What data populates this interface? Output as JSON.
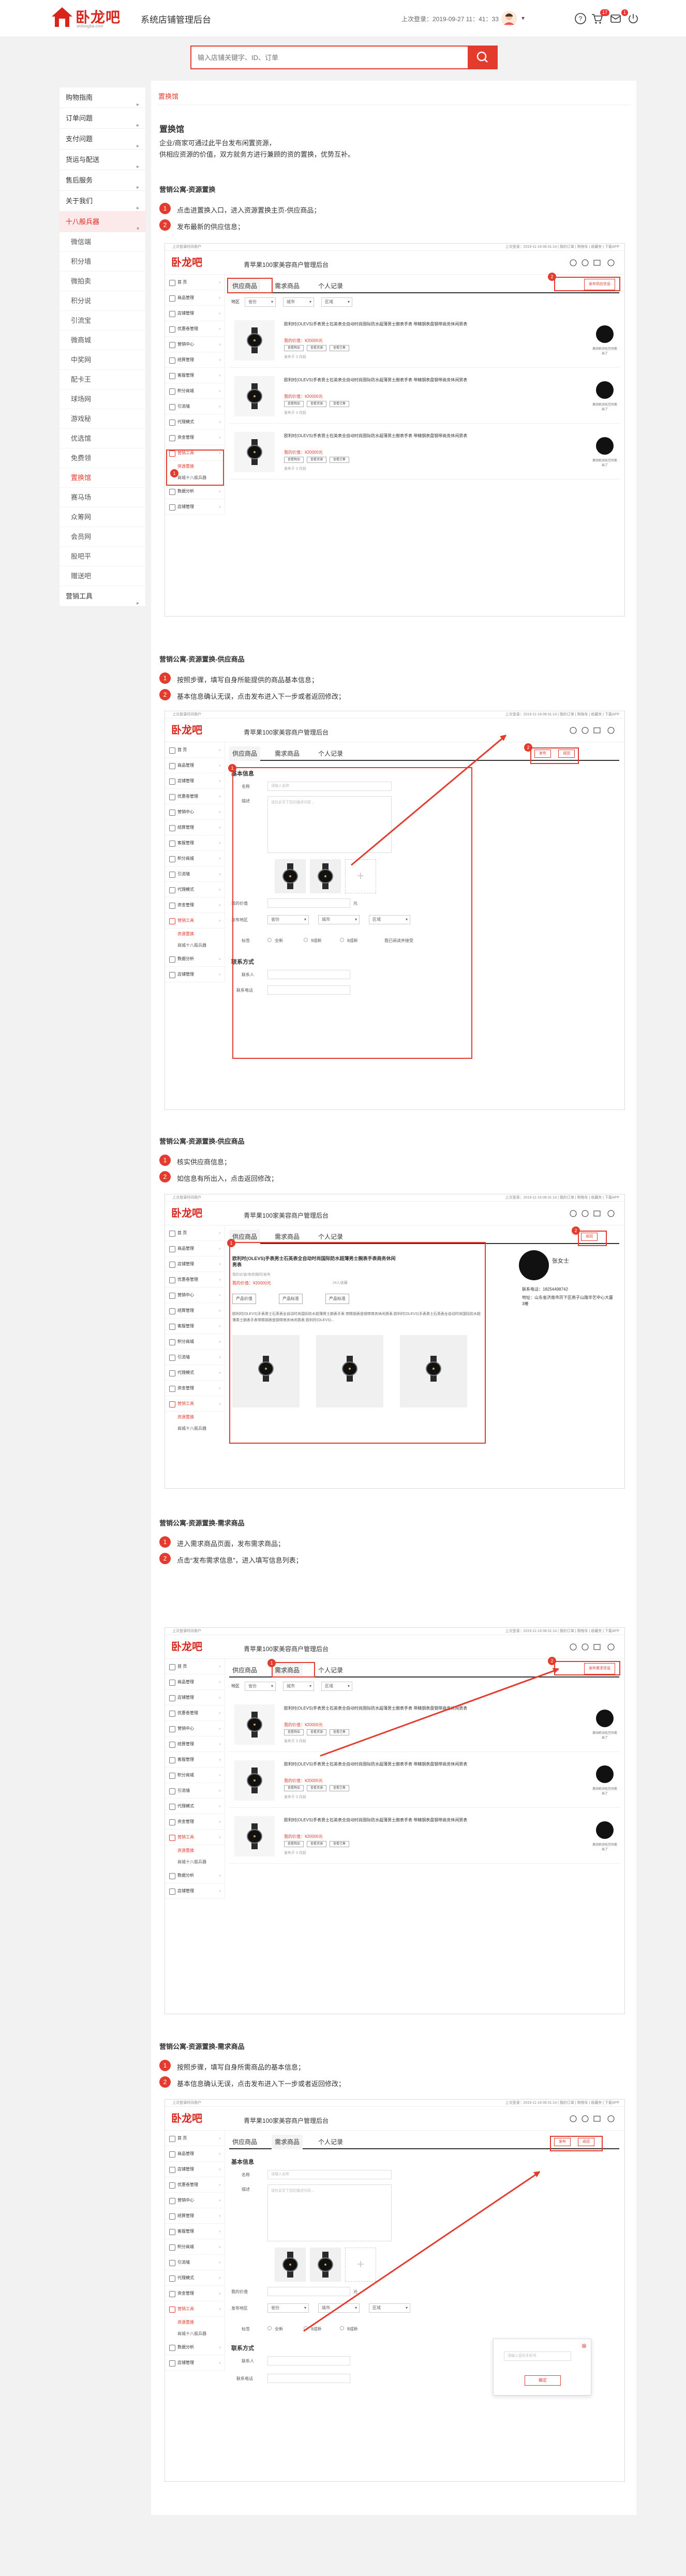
{
  "topbar": {
    "logo": "卧龙吧",
    "logo_sub": "wolongba.com",
    "site_title": "系统店铺管理后台",
    "last_login": "上次登录：2019-09-27  11：41：33",
    "cart_badge": "17",
    "msg_badge": "1"
  },
  "search": {
    "placeholder": "输入店铺关键字、ID、订单"
  },
  "sidebar": {
    "groups": [
      {
        "label": "购物指南"
      },
      {
        "label": "订单问题"
      },
      {
        "label": "支付问题"
      },
      {
        "label": "货运与配送"
      },
      {
        "label": "售后服务"
      },
      {
        "label": "关于我们"
      },
      {
        "label": "十八般兵器",
        "expanded": true
      }
    ],
    "sub_items": [
      "微信端",
      "积分墙",
      "微拍卖",
      "积分说",
      "引流宝",
      "微商城",
      "中奖网",
      "配卡王",
      "球场网",
      "游戏秘",
      "优选馆",
      "免费领",
      "置换馆",
      "赛马场",
      "众筹网",
      "会员网",
      "股吧平",
      "赠送吧"
    ],
    "active_sub": "置换馆",
    "last_group": "营销工具"
  },
  "crumb": "置换馆",
  "intro": {
    "title": "置换馆",
    "line1": "企业/商家可通过此平台发布闲置资源，",
    "line2": "供相应资源的价值，双方就务方进行兼顾的资的置换，优势互补。"
  },
  "sections": [
    {
      "heading": "营销公寓-资源置换",
      "steps": [
        "点击进置换入口，进入资源置换主页-供应商品；",
        "发布最新的供应信息；"
      ]
    },
    {
      "heading": "营销公寓-资源置换-供应商品",
      "steps": [
        "按照步骤，填写自身所能提供的商品基本信息；",
        "基本信息确认无误，点击发布进入下一步或者返回修改；"
      ]
    },
    {
      "heading": "营销公寓-资源置换-供应商品",
      "steps": [
        "核实供应商信息；",
        "如信息有所出入，点击返回修改；"
      ]
    },
    {
      "heading": "营销公寓-资源置换-需求商品",
      "steps": [
        "进入需求商品页面，发布需求商品；",
        "点击“发布需求信息”，进入填写信息列表；"
      ]
    },
    {
      "heading": "营销公寓-资源置换-需求商品",
      "steps": [
        "按照步骤，填写自身所需商品的基本信息；",
        "基本信息确认无误，点击发布进入下一步或者返回修改；"
      ]
    }
  ],
  "mock": {
    "top_left": "上次登录时间用户",
    "top_right": "上次登录：2019-11-18 08:31:14  |  我的订单  |  购物车  |  收藏夹  |  下载APP",
    "title": "青苹果100家美容商户管理后台",
    "side": [
      "首 页",
      "商品管理",
      "店铺管理",
      "优惠卷管理",
      "营销中心",
      "结算管理",
      "客服管理",
      "积分商城",
      "引流墙",
      "代理模式",
      "资金管理",
      "营销工具"
    ],
    "side_sub": [
      "资源置换",
      "商城十八般兵器"
    ],
    "side_tail": [
      "数据分析",
      "店铺管理"
    ],
    "tabs": [
      "供应商品",
      "需求商品",
      "个人记录"
    ],
    "filters": [
      "地区",
      "省份",
      "城市",
      "区域"
    ],
    "publish_supply": "发布供应信息",
    "publish_demand": "发布需求信息",
    "item_title": "欧利时(OLEVS)手表男士石英表全自动时尚国际防水超薄男士腕表手表 带精钢表盘钢带商务休闲男表",
    "item_price": "我的价值：¥20000元",
    "item_btns": [
      "查看物品",
      "查看资源",
      "查看已售"
    ],
    "item_small": "发布于 3 月前",
    "seller": "滚动机动化空间卖出了",
    "form": {
      "basic": "基本信息",
      "contact": "联系方式",
      "name_lab": "名称",
      "desc_lab": "描述",
      "val_lab": "我的价值",
      "val_unit": "元",
      "area_lab": "发布地区",
      "tag_lab": "标签",
      "phone_lab": "联系人",
      "mobile_lab": "联系电话",
      "name_ph": "请输入名称",
      "desc_ph": "请在此写下您的描述内容…",
      "tags": [
        "全新",
        "9成新",
        "8成新"
      ],
      "agree": "我已阅读并接受",
      "publish": "发布",
      "back": "返回"
    },
    "detail": {
      "title": "欧利时(OLEVS)手表男士石英表全自动时尚国际防水超薄男士腕表手表商务休闲男表",
      "sub": "我的价值/有效期间/发布",
      "price": "我的价值：¥20000元",
      "count": "24人收藏",
      "btns": [
        "产品价值",
        "产品标准",
        "产品标准"
      ],
      "desc": "欧利时(OLEVS)手表男士石英表全自动时尚国际防水超薄男士腕表手表 带精钢表盘钢带商务休闲男表 欧利时(OLEVS)手表男士石英表全自动时尚国际防水超薄男士腕表手表带精钢表盘钢带商务休闲男表 欧利时(OLEVS)...",
      "seller_name": "张女士",
      "phone": "联系电话：18254498742",
      "addr": "地址：山东省济南市历下区燕子山路华艺中心大厦3楼"
    },
    "dialog_ph": "请输入您的手机号",
    "dialog_ok": "确定"
  }
}
